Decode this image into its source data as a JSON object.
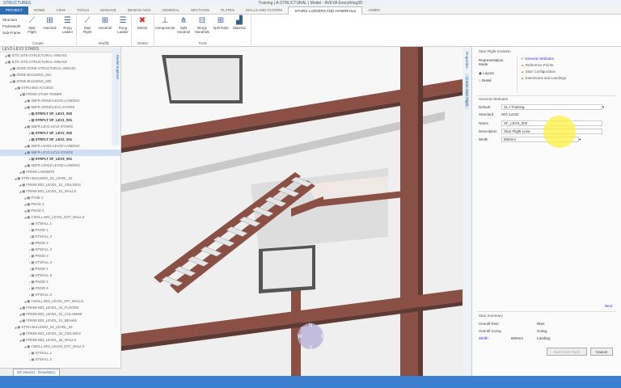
{
  "title": "Training | A-STRUCTURAL | Model - AVEVA Everything3D",
  "quick_access": "STRUCTURES",
  "tabs": [
    "PROJECT",
    "HOME",
    "VIEW",
    "TOOLS",
    "MANAGE",
    "DESIGN AIDS",
    "GENERAL",
    "SECTIONS",
    "PLATES",
    "WALLS AND FLOORS",
    "STAIRS LADDERS AND HANDRAILS",
    "ADMIN"
  ],
  "ribbon": {
    "create_small": [
      "Structure",
      "Framework",
      "Sub-Frame"
    ],
    "create": [
      "Stair Flight",
      "Handrail",
      "Rung Ladder"
    ],
    "create_label": "Create",
    "modify": [
      "Stair Flight",
      "Handrail",
      "Rung Ladder"
    ],
    "modify_label": "Modify",
    "delete": [
      "Delete"
    ],
    "delete_label": "Delete",
    "tools": [
      "Components",
      "Split Handrail",
      "Merge Handrails",
      "Split Rails",
      "Material"
    ],
    "tools_label": "Tools"
  },
  "tree": {
    "header": "LEV2-LEV3 STAIRS",
    "side_tab": "Model Explorer",
    "items": [
      {
        "l": 1,
        "t": "SITE SITE-STRUCTURAL-AREA01"
      },
      {
        "l": 1,
        "t": "SITE SITE-STRUCTURAL-AREA02"
      },
      {
        "l": 2,
        "t": "ZONE ZONE-STRUCTURAL-AREA02"
      },
      {
        "l": 2,
        "t": "ZONE BUILDING_001"
      },
      {
        "l": 2,
        "t": "ZONE BUILDING_002"
      },
      {
        "l": 3,
        "t": "STRU B02-ACCESS"
      },
      {
        "l": 4,
        "t": "FRMW STAIR-TOWER"
      },
      {
        "l": 5,
        "t": "SBFR GRND-LEV01-LANDING"
      },
      {
        "l": 5,
        "t": "SBFR GRND-LEV1-STAIRS"
      },
      {
        "l": 6,
        "t": "STRFLT SF_LEV1_002",
        "b": 1
      },
      {
        "l": 6,
        "t": "STRFLT SF_LEV1_001",
        "b": 1
      },
      {
        "l": 5,
        "t": "SBFR LEV1-LEV2-STAIRS"
      },
      {
        "l": 6,
        "t": "STRFLT SF_LEV2_002",
        "b": 1
      },
      {
        "l": 6,
        "t": "STRFLT SF_LEV2_001",
        "b": 1
      },
      {
        "l": 5,
        "t": "SBFR LEV01-LEV02-LANDING"
      },
      {
        "l": 5,
        "t": "SBFR LEV2-LEV3-STAIRS",
        "s": 1
      },
      {
        "l": 6,
        "t": "STRFLT SF_LEV3_001",
        "b": 1
      },
      {
        "l": 5,
        "t": "SBFR LEV02-LEV03-LANDING"
      },
      {
        "l": 4,
        "t": "FRMW LADDERS"
      },
      {
        "l": 3,
        "t": "STRU BUILDING_02_LEVEL_01"
      },
      {
        "l": 4,
        "t": "FRMW B02_LEVEL_01_CEILINGS"
      },
      {
        "l": 4,
        "t": "FRMW B02_LEVEL_01_WALLS"
      },
      {
        "l": 5,
        "t": "PANE 1"
      },
      {
        "l": 5,
        "t": "PNOD 1"
      },
      {
        "l": 5,
        "t": "PNOD 2"
      },
      {
        "l": 5,
        "t": "CWALL B02_LEV01_EXT_WALLS"
      },
      {
        "l": 6,
        "t": "STWALL 1"
      },
      {
        "l": 6,
        "t": "PNOD 1"
      },
      {
        "l": 6,
        "t": "STWALL 2"
      },
      {
        "l": 6,
        "t": "PNOD 2"
      },
      {
        "l": 6,
        "t": "STWALL 3"
      },
      {
        "l": 6,
        "t": "PNOD 3"
      },
      {
        "l": 6,
        "t": "STWALL 4"
      },
      {
        "l": 6,
        "t": "PNOD 4"
      },
      {
        "l": 6,
        "t": "STWALL 5"
      },
      {
        "l": 6,
        "t": "PNOD 5"
      },
      {
        "l": 6,
        "t": "PNOD 6"
      },
      {
        "l": 6,
        "t": "STWALL 6"
      },
      {
        "l": 5,
        "t": "CWALL B02_LEV01_INT_WALLS"
      },
      {
        "l": 4,
        "t": "FRMW B02_LEVEL_01_FLOORS"
      },
      {
        "l": 4,
        "t": "FRMW B02_LEVEL_01_COLUMNS"
      },
      {
        "l": 4,
        "t": "FRMW B02_LEVEL_01_BEAMS"
      },
      {
        "l": 3,
        "t": "STRU BUILDING_02_LEVEL_02"
      },
      {
        "l": 4,
        "t": "FRMW B02_LEVEL_02_CEILINGS"
      },
      {
        "l": 4,
        "t": "FRMW B02_LEVEL_02_WALLS"
      },
      {
        "l": 5,
        "t": "CWALL B02_LEV02_EXT_WALLS"
      },
      {
        "l": 6,
        "t": "STWALL 1"
      },
      {
        "l": 6,
        "t": "STWALL 2"
      }
    ]
  },
  "view_tab": "3D View(1) - Drawlist(1)",
  "side_tabs": [
    "Properties",
    "Create Stair Flight"
  ],
  "panel": {
    "title": "Stair Flight Creation",
    "rep_mode_label": "Representation Mode",
    "modes": [
      "Layout",
      "Detail"
    ],
    "steps": [
      "General Attributes",
      "Reference Points",
      "Stair Configuration",
      "Extensions and Landings"
    ],
    "general_title": "General Attributes",
    "fields": [
      {
        "label": "Default",
        "value": "SLA Training"
      },
      {
        "label": "Standard",
        "value": "ISO 14122"
      },
      {
        "label": "Name",
        "value": "SF_LEV3_002"
      },
      {
        "label": "Description",
        "value": "Stair Flight Leve"
      },
      {
        "label": "Width",
        "value": "800mm"
      }
    ],
    "next": "Next",
    "summary_title": "Stair Summary",
    "summary": [
      {
        "k": "Overall Rise:",
        "v": "",
        "k2": "Rise:"
      },
      {
        "k": "Overall Going:",
        "v": "",
        "k2": "Going:"
      },
      {
        "k": "Width:",
        "v": "800mm",
        "k2": "Landing:"
      }
    ],
    "build_button": "Build Stair Flight",
    "cancel_button": "Cancel"
  },
  "nav_cube": [
    "N",
    "E",
    "S",
    "W"
  ]
}
